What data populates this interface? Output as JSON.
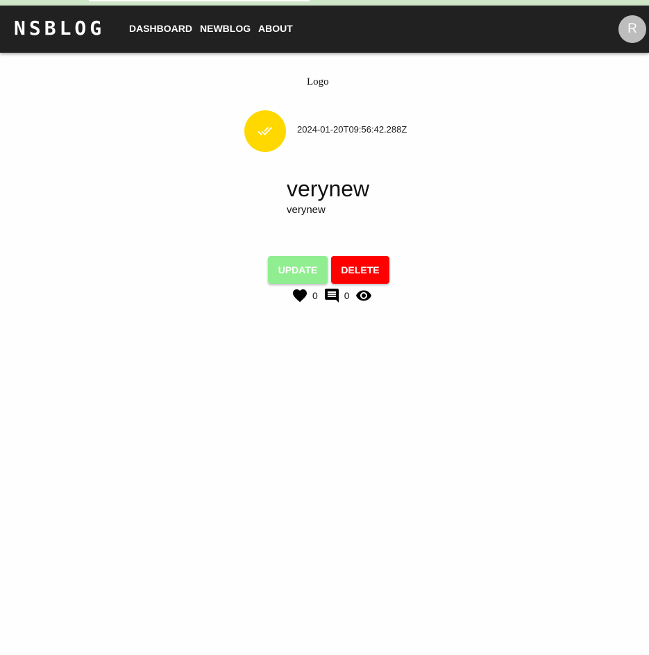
{
  "navbar": {
    "brand": "NSBLOG",
    "links": [
      {
        "label": "DASHBOARD"
      },
      {
        "label": "NEWBLOG"
      },
      {
        "label": "ABOUT"
      }
    ],
    "avatar_initial": "R",
    "background_color": "#212121"
  },
  "post": {
    "logo_alt": "Logo",
    "status_icon": "done-all-icon",
    "status_color": "#ffd800",
    "timestamp": "2024-01-20T09:56:42.288Z",
    "title": "verynew",
    "body": "verynew"
  },
  "actions": {
    "update_label": "UPDATE",
    "update_color": "#90ee90",
    "delete_label": "DELETE",
    "delete_color": "#ff0000"
  },
  "stats": {
    "like_icon": "heart-icon",
    "likes": "0",
    "comment_icon": "comment-icon",
    "comments": "0",
    "view_icon": "eye-icon"
  }
}
